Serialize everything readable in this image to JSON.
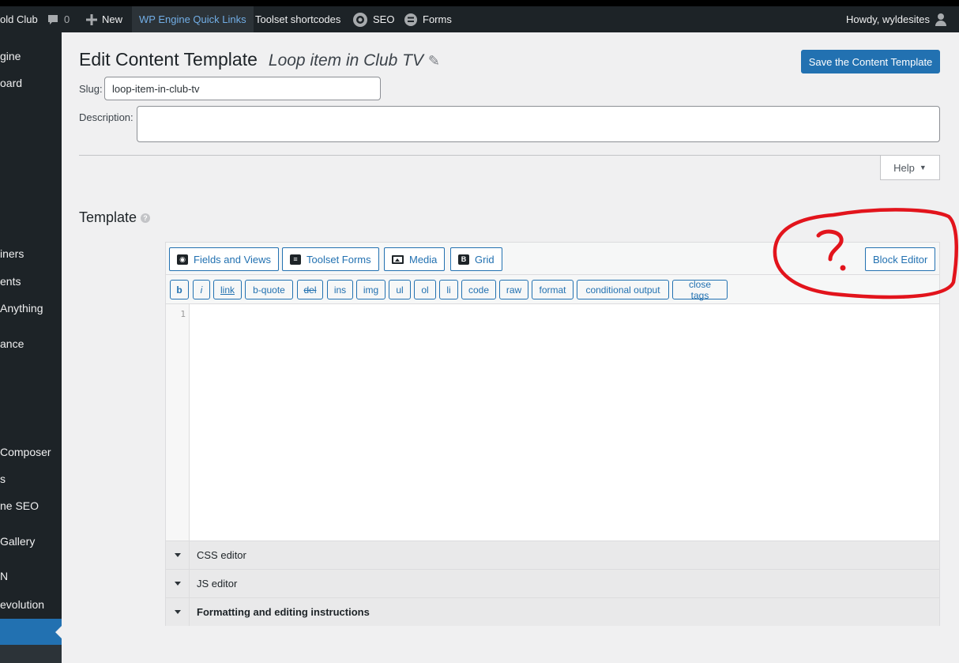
{
  "adminbar": {
    "site_name": "old Club",
    "comments_count": "0",
    "new_label": "New",
    "quick_links": "WP Engine Quick Links",
    "toolset_shortcodes": "Toolset shortcodes",
    "seo": "SEO",
    "forms": "Forms",
    "howdy": "Howdy, wyldesites"
  },
  "sidebar": {
    "items": [
      {
        "label": "gine"
      },
      {
        "label": "oard"
      },
      {
        "label": "iners"
      },
      {
        "label": "ents"
      },
      {
        "label": "Anything"
      },
      {
        "label": "ance"
      },
      {
        "label": "Composer"
      },
      {
        "label": "s"
      },
      {
        "label": "ne SEO"
      },
      {
        "label": "Gallery"
      },
      {
        "label": "N"
      },
      {
        "label": "evolution"
      }
    ]
  },
  "page": {
    "title": "Edit Content Template",
    "template_name": "Loop item in Club TV",
    "save_button": "Save the Content Template",
    "slug_label": "Slug:",
    "slug_value": "loop-item-in-club-tv",
    "description_label": "Description:",
    "description_value": "",
    "help_label": "Help",
    "section_title": "Template"
  },
  "editor": {
    "toolbar": {
      "fields_and_views": "Fields and Views",
      "toolset_forms": "Toolset Forms",
      "media": "Media",
      "grid": "Grid",
      "block_editor": "Block Editor"
    },
    "quicktags": [
      "b",
      "i",
      "link",
      "b-quote",
      "del",
      "ins",
      "img",
      "ul",
      "ol",
      "li",
      "code",
      "raw",
      "format",
      "conditional output",
      "close tags"
    ],
    "line_number": "1",
    "panels": [
      {
        "label": "CSS editor"
      },
      {
        "label": "JS editor"
      },
      {
        "label": "Formatting and editing instructions"
      }
    ]
  },
  "colors": {
    "admin_dark": "#1d2327",
    "primary_blue": "#2271b1",
    "annotation_red": "#e2141c"
  }
}
